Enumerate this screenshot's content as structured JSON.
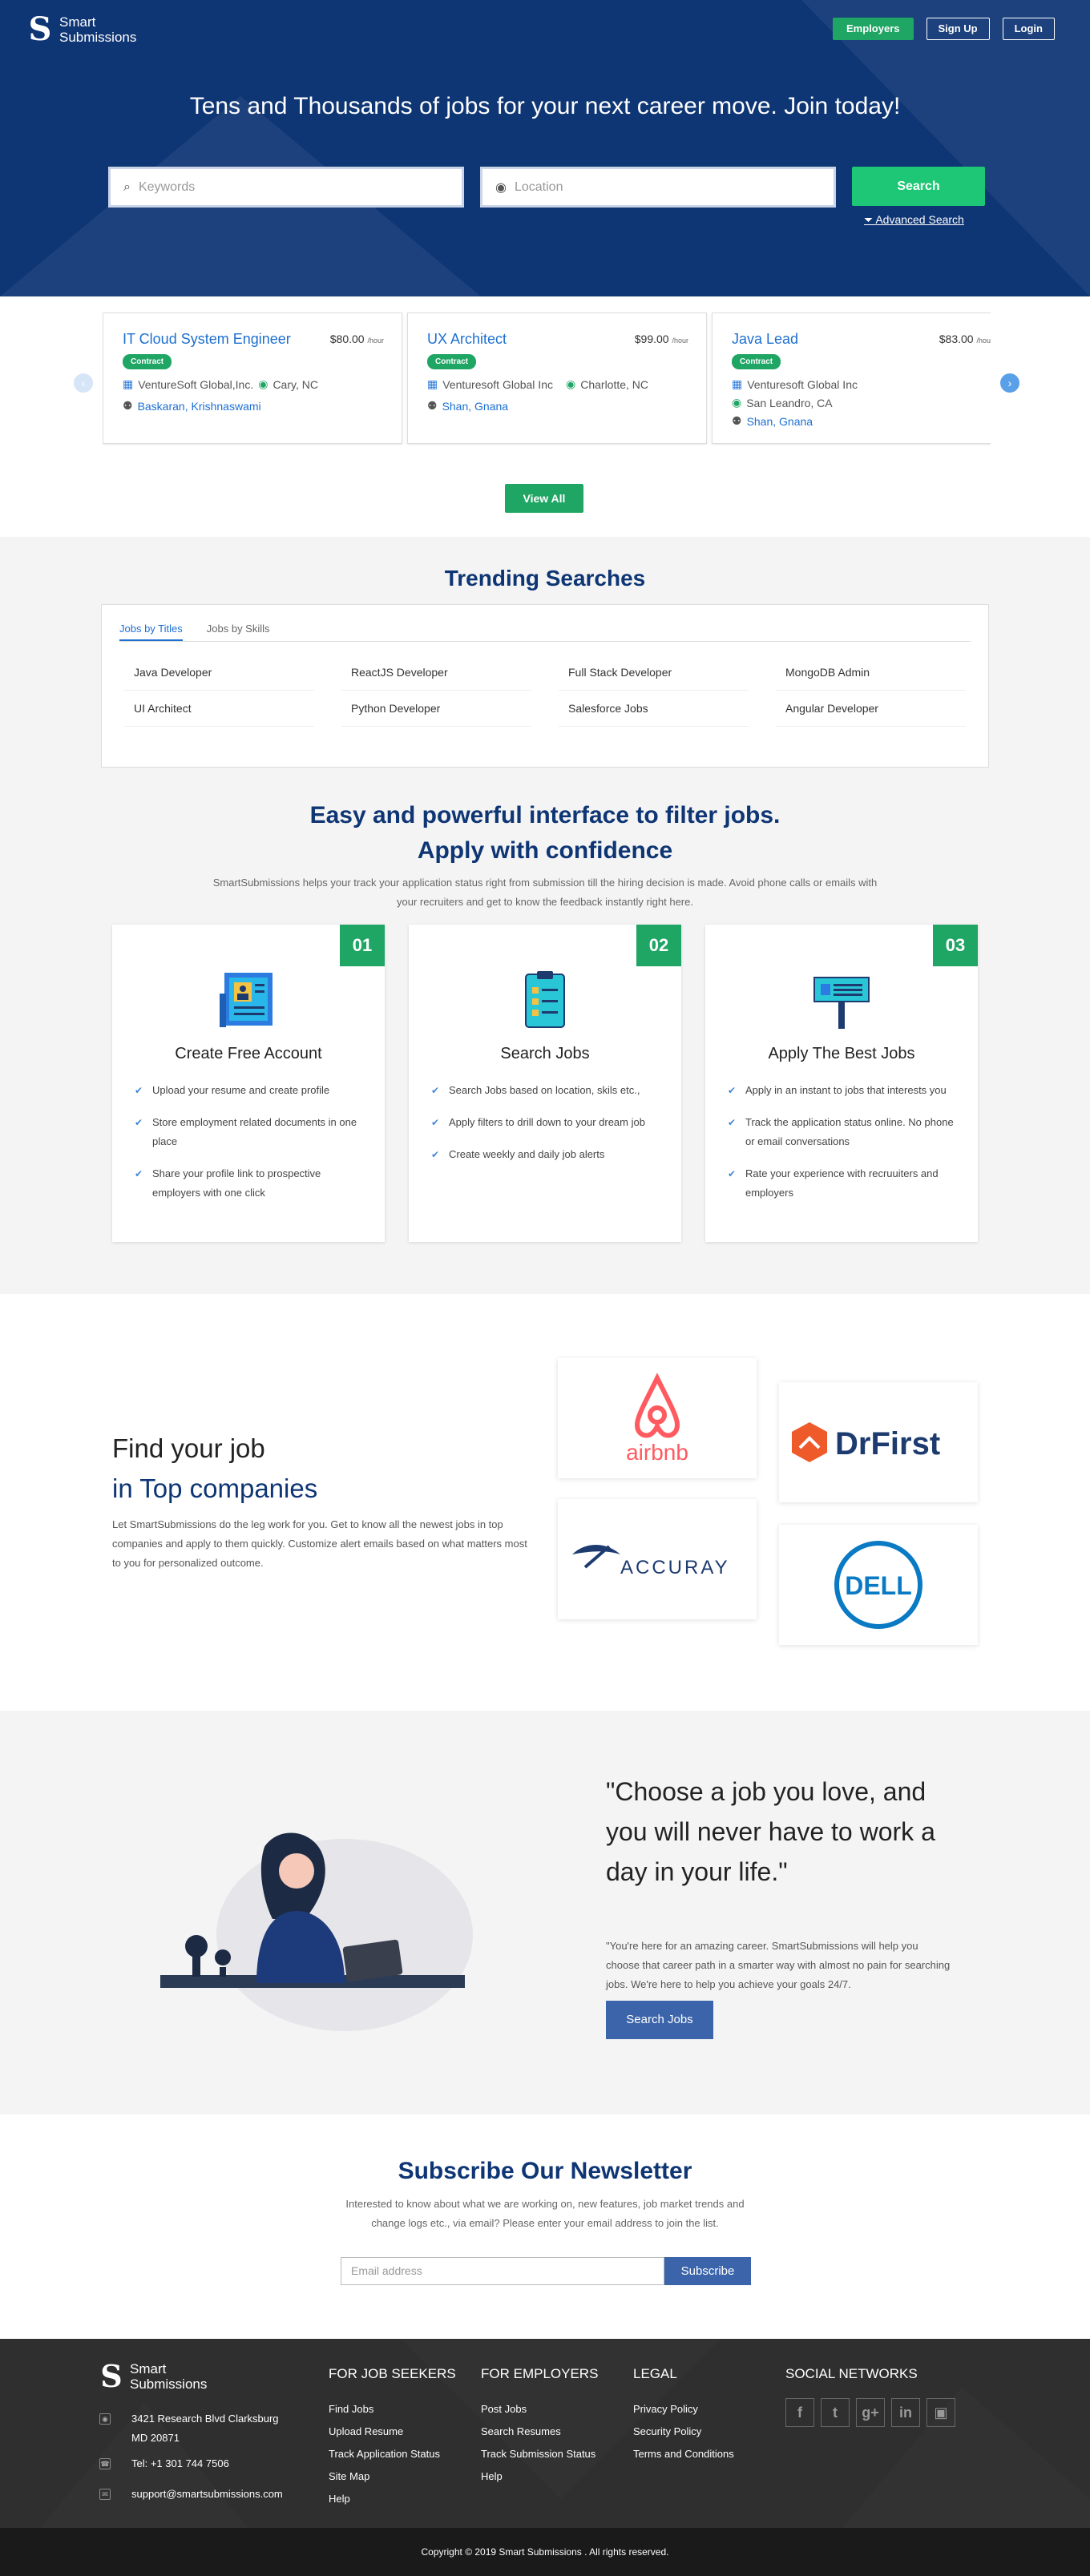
{
  "header": {
    "logo_line1": "Smart",
    "logo_line2": "Submissions",
    "employers": "Employers",
    "signup": "Sign Up",
    "login": "Login",
    "headline": "Tens and Thousands of jobs for your next career move. Join today!",
    "keywords_placeholder": "Keywords",
    "location_placeholder": "Location",
    "search": "Search",
    "advanced": "Advanced Search"
  },
  "jobs": [
    {
      "title": "IT Cloud System Engineer",
      "rate": "$80.00",
      "unit": "/hour",
      "type": "Contract",
      "company": "VentureSoft Global,Inc.",
      "location": "Cary, NC",
      "recruiters": "Baskaran, Krishnaswami"
    },
    {
      "title": "UX Architect",
      "rate": "$99.00",
      "unit": "/hour",
      "type": "Contract",
      "company": "Venturesoft Global Inc",
      "location": "Charlotte, NC",
      "recruiters": "Shan, Gnana"
    },
    {
      "title": "Java Lead",
      "rate": "$83.00",
      "unit": "/hour",
      "type": "Contract",
      "company": "Venturesoft Global Inc",
      "location": "San Leandro, CA",
      "recruiters": "Shan, Gnana"
    }
  ],
  "view_all": "View All",
  "trending": {
    "title": "Trending Searches",
    "tabs": [
      "Jobs by Titles",
      "Jobs by Skills"
    ],
    "items": [
      "Java Developer",
      "ReactJS Developer",
      "Full Stack Developer",
      "MongoDB Admin",
      "UI Architect",
      "Python Developer",
      "Salesforce Jobs",
      "Angular Developer"
    ]
  },
  "interface": {
    "title1": "Easy and powerful interface to filter jobs.",
    "title2": "Apply with confidence",
    "desc": "SmartSubmissions helps your track your application status right from submission till the hiring decision is made. Avoid phone calls or emails with your recruiters and get to know the feedback instantly right here.",
    "features": [
      {
        "num": "01",
        "title": "Create Free Account",
        "points": [
          "Upload your resume and create profile",
          "Store employment related documents in one place",
          "Share your profile link to prospective employers with one click"
        ]
      },
      {
        "num": "02",
        "title": "Search Jobs",
        "points": [
          "Search Jobs based on location, skils etc.,",
          "Apply filters to drill down to your dream job",
          "Create weekly and daily job alerts"
        ]
      },
      {
        "num": "03",
        "title": "Apply The Best Jobs",
        "points": [
          "Apply in an instant to jobs that interests you",
          "Track the application status online. No phone or email conversations",
          "Rate your experience with recruuiters and employers"
        ]
      }
    ]
  },
  "companies": {
    "title1": "Find your job",
    "title2": "in Top companies",
    "desc": "Let SmartSubmissions do the leg work for you. Get to know all the newest jobs in top companies and apply to them quickly. Customize alert emails based on what matters most to you for personalized outcome.",
    "logos": [
      "airbnb",
      "DrFirst",
      "ACCURAY",
      "DELL"
    ]
  },
  "quote": {
    "text": "\"Choose a job you love, and you will never have to work a day in your life.\"",
    "sub": "\"You're here for an amazing career. SmartSubmissions will help you choose that career path in a smarter way with almost no pain for searching jobs. We're here to help you achieve your goals 24/7.",
    "button": "Search Jobs"
  },
  "newsletter": {
    "title": "Subscribe Our Newsletter",
    "desc": "Interested to know about what we are working on, new features, job market trends and change logs etc., via email? Please enter your email address to join the list.",
    "placeholder": "Email address",
    "button": "Subscribe"
  },
  "footer": {
    "address1": "3421 Research Blvd Clarksburg",
    "address2": "MD 20871",
    "tel": "Tel: +1 301 744 7506",
    "email": "support@smartsubmissions.com",
    "seekers": {
      "title": "FOR JOB SEEKERS",
      "links": [
        "Find Jobs",
        "Upload Resume",
        "Track Application Status",
        "Site Map",
        "Help"
      ]
    },
    "employers": {
      "title": "FOR EMPLOYERS",
      "links": [
        "Post Jobs",
        "Search Resumes",
        "Track Submission Status",
        "Help"
      ]
    },
    "legal": {
      "title": "LEGAL",
      "links": [
        "Privacy Policy",
        "Security Policy",
        "Terms and Conditions"
      ]
    },
    "social": {
      "title": "SOCIAL NETWORKS",
      "icons": [
        "facebook-icon",
        "twitter-icon",
        "google-plus-icon",
        "linkedin-icon",
        "instagram-icon"
      ]
    },
    "copyright": "Copyright © 2019 Smart Submissions . All rights reserved."
  },
  "colors": {
    "navy": "#0e3574",
    "green": "#1fa564",
    "bright_green": "#1ec775",
    "blue": "#1d6fd1",
    "button_blue": "#3b64aa"
  }
}
